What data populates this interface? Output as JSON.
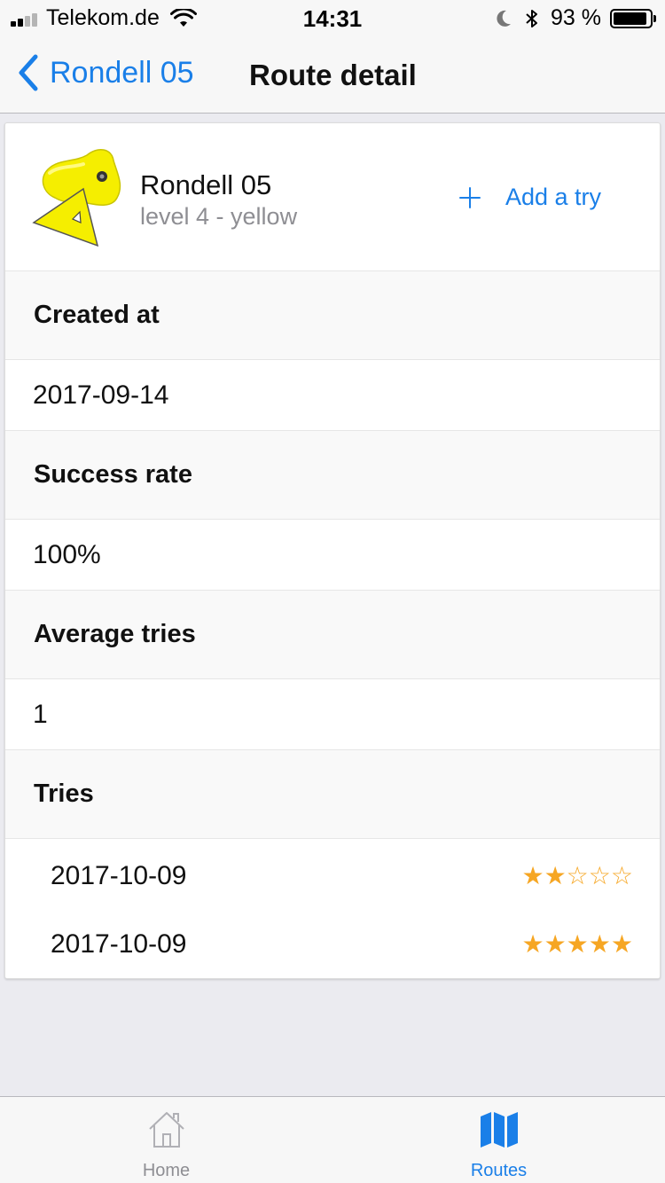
{
  "status_bar": {
    "carrier": "Telekom.de",
    "time": "14:31",
    "battery": "93 %",
    "battery_level": 0.93
  },
  "nav": {
    "back_label": "Rondell 05",
    "title": "Route detail"
  },
  "route": {
    "name": "Rondell 05",
    "level": "level 4 - yellow",
    "hold_color": "#f5ee00",
    "add_try_label": "Add a try"
  },
  "sections": {
    "created_at": {
      "label": "Created at",
      "value": "2017-09-14"
    },
    "success_rate": {
      "label": "Success rate",
      "value": "100%"
    },
    "average_tries": {
      "label": "Average tries",
      "value": "1"
    },
    "tries": {
      "label": "Tries",
      "items": [
        {
          "date": "2017-10-09",
          "rating": 2,
          "max": 5
        },
        {
          "date": "2017-10-09",
          "rating": 5,
          "max": 5
        }
      ]
    }
  },
  "tabs": [
    {
      "label": "Home",
      "icon": "home-icon",
      "active": false
    },
    {
      "label": "Routes",
      "icon": "map-icon",
      "active": true
    }
  ],
  "colors": {
    "accent": "#1a7fe8",
    "star": "#f6a623"
  }
}
